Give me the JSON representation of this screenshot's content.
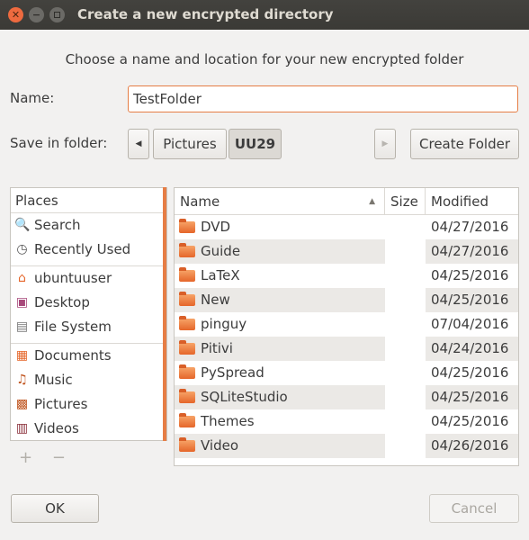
{
  "window": {
    "title": "Create a new encrypted directory"
  },
  "dialog": {
    "subtitle": "Choose a name and location for your new encrypted folder",
    "name_label": "Name:",
    "name_value": "TestFolder",
    "save_label": "Save in folder:",
    "breadcrumb": [
      "Pictures",
      "UU29"
    ],
    "create_folder": "Create Folder"
  },
  "places": {
    "header": "Places",
    "items": [
      {
        "label": "Search",
        "icon": "search-icon"
      },
      {
        "label": "Recently Used",
        "icon": "clock-icon"
      },
      {
        "label": "ubuntuuser",
        "icon": "home-folder-icon"
      },
      {
        "label": "Desktop",
        "icon": "desktop-icon"
      },
      {
        "label": "File System",
        "icon": "drive-icon"
      },
      {
        "label": "Documents",
        "icon": "documents-folder-icon"
      },
      {
        "label": "Music",
        "icon": "music-folder-icon"
      },
      {
        "label": "Pictures",
        "icon": "pictures-folder-icon"
      },
      {
        "label": "Videos",
        "icon": "videos-folder-icon"
      }
    ],
    "add": "+",
    "remove": "−"
  },
  "files": {
    "columns": [
      "Name",
      "Size",
      "Modified"
    ],
    "rows": [
      {
        "name": "DVD",
        "size": "",
        "modified": "04/27/2016"
      },
      {
        "name": "Guide",
        "size": "",
        "modified": "04/27/2016"
      },
      {
        "name": "LaTeX",
        "size": "",
        "modified": "04/25/2016"
      },
      {
        "name": "New",
        "size": "",
        "modified": "04/25/2016"
      },
      {
        "name": "pinguy",
        "size": "",
        "modified": "07/04/2016"
      },
      {
        "name": "Pitivi",
        "size": "",
        "modified": "04/24/2016"
      },
      {
        "name": "PySpread",
        "size": "",
        "modified": "04/25/2016"
      },
      {
        "name": "SQLiteStudio",
        "size": "",
        "modified": "04/25/2016"
      },
      {
        "name": "Themes",
        "size": "",
        "modified": "04/25/2016"
      },
      {
        "name": "Video",
        "size": "",
        "modified": "04/26/2016"
      }
    ]
  },
  "buttons": {
    "ok": "OK",
    "cancel": "Cancel"
  },
  "colors": {
    "accent": "#e67d45",
    "titlebar": "#3d3c38",
    "folder": "#ef8a48"
  }
}
